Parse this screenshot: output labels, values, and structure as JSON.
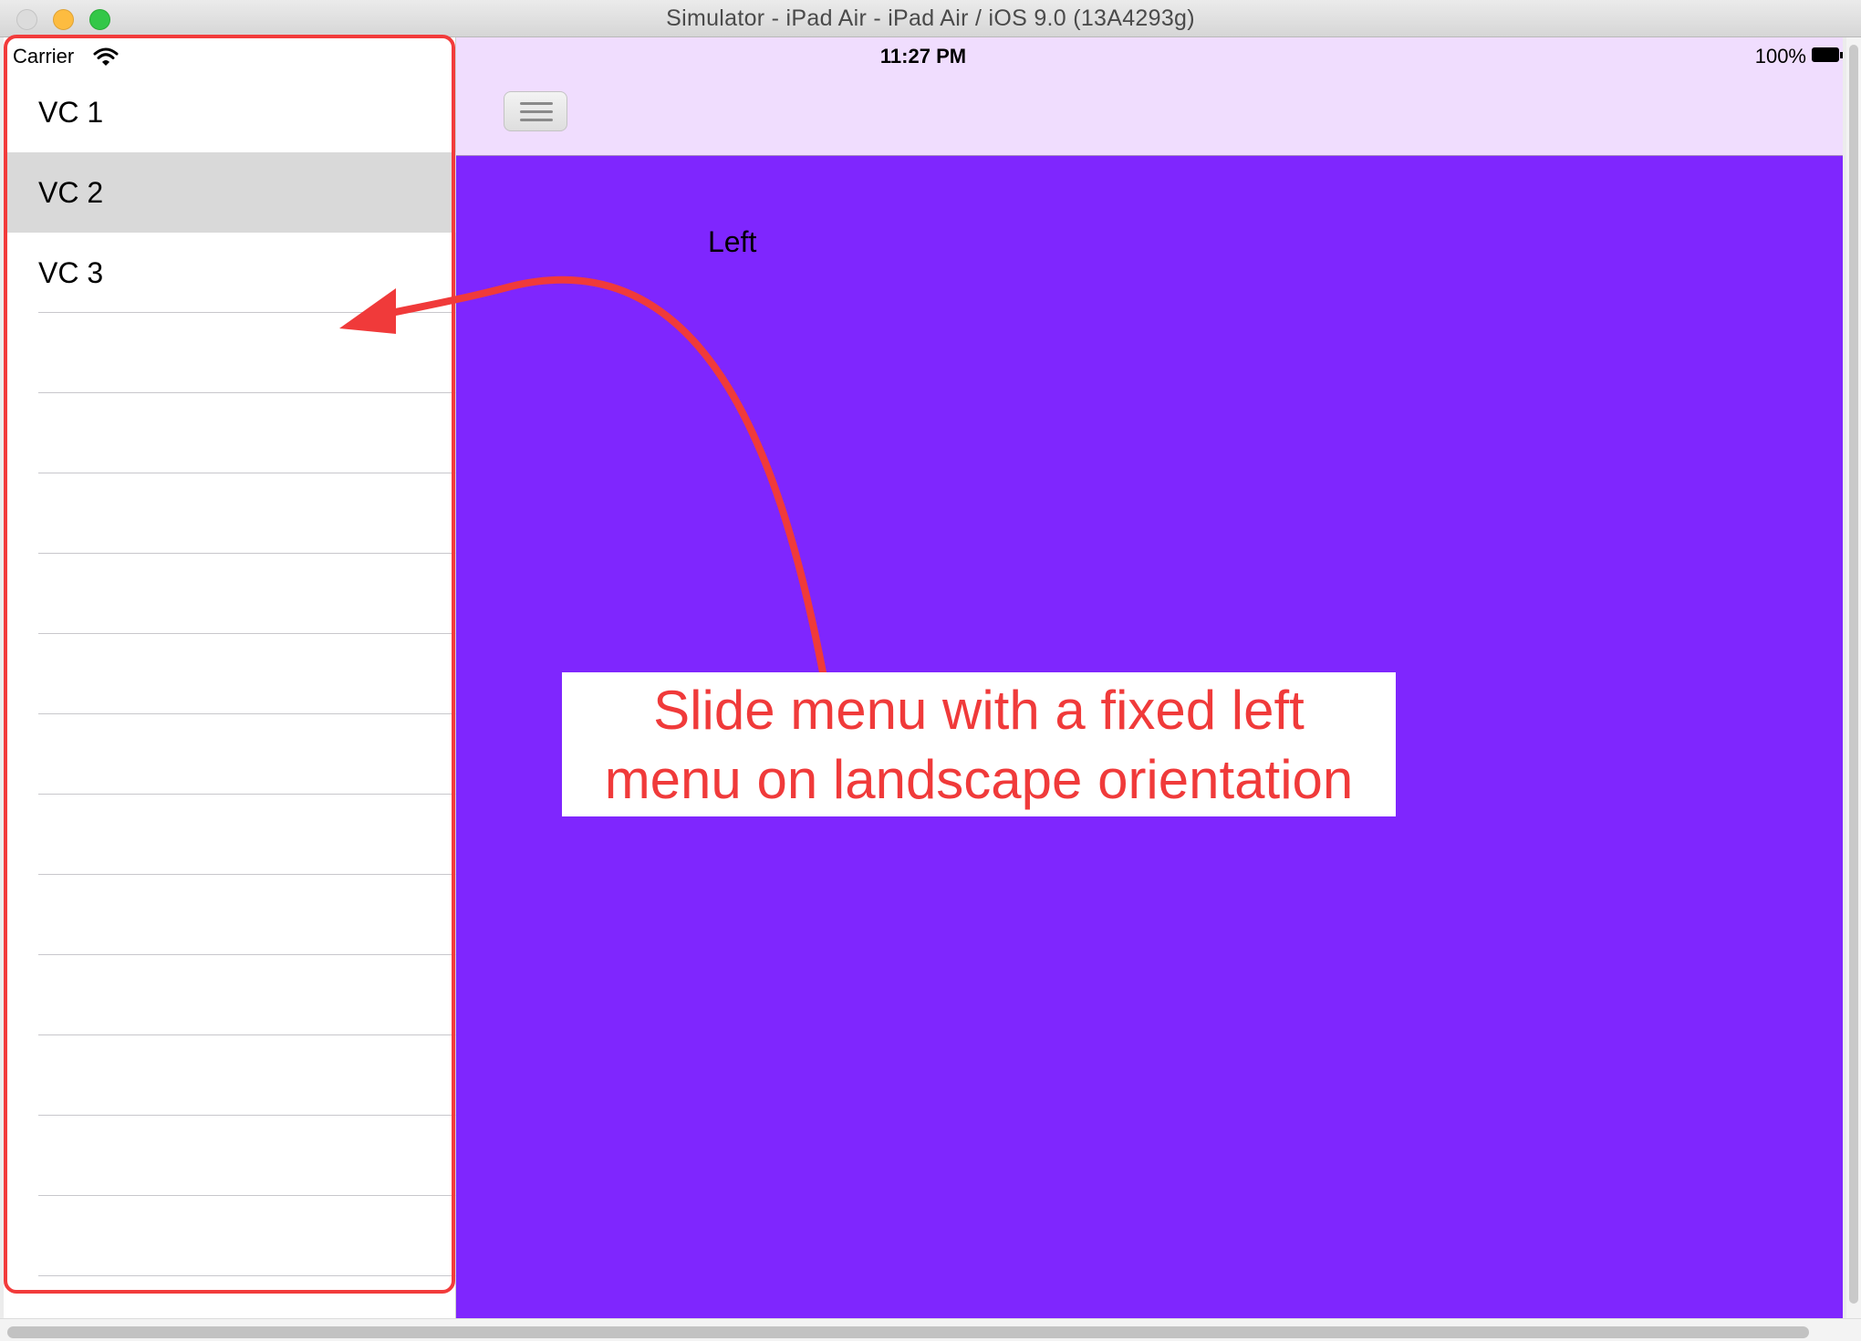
{
  "window": {
    "title": "Simulator - iPad Air - iPad Air / iOS 9.0 (13A4293g)"
  },
  "status_bar": {
    "carrier": "Carrier",
    "time": "11:27 PM",
    "battery": "100%"
  },
  "menu": {
    "items": [
      {
        "label": "VC 1",
        "selected": false
      },
      {
        "label": "VC 2",
        "selected": true
      },
      {
        "label": "VC 3",
        "selected": false
      }
    ]
  },
  "main": {
    "label": "Left",
    "nav_button_icon": "hamburger-icon"
  },
  "annotation": {
    "line1": "Slide menu with a fixed left",
    "line2": "menu on landscape orientation",
    "color": "#f03a3a"
  },
  "colors": {
    "content_bg": "#7f26fe",
    "navbar_bg": "#f0ddfe",
    "selected_row": "#d9d9d9"
  }
}
